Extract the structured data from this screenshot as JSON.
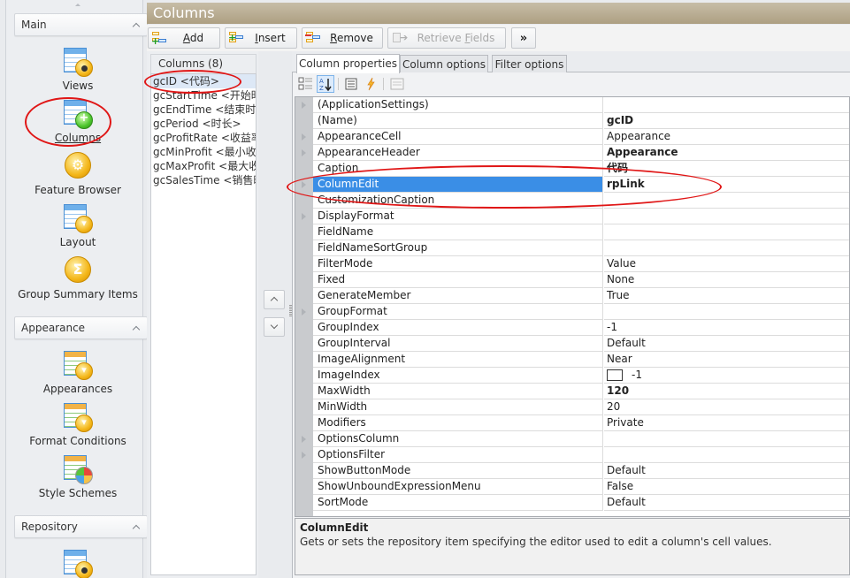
{
  "window": {
    "title": "Columns"
  },
  "nav": {
    "groups": [
      {
        "label": "Main",
        "items": [
          {
            "label": "Views",
            "icon": "views-icon"
          },
          {
            "label": "Columns",
            "icon": "columns-icon",
            "selected": true
          },
          {
            "label": "Feature Browser",
            "icon": "feature-browser-icon"
          },
          {
            "label": "Layout",
            "icon": "layout-icon"
          },
          {
            "label": "Group Summary Items",
            "icon": "group-summary-icon"
          }
        ]
      },
      {
        "label": "Appearance",
        "items": [
          {
            "label": "Appearances",
            "icon": "appearances-icon"
          },
          {
            "label": "Format Conditions",
            "icon": "format-conditions-icon"
          },
          {
            "label": "Style Schemes",
            "icon": "style-schemes-icon"
          }
        ]
      },
      {
        "label": "Repository",
        "items": [
          {
            "label": "",
            "icon": "repository-icon"
          }
        ]
      }
    ]
  },
  "toolbar": {
    "add": {
      "label": "Add",
      "mnemonic": "A",
      "rest": "dd"
    },
    "insert": {
      "label": "Insert",
      "mnemonic": "I",
      "rest": "nsert"
    },
    "remove": {
      "label": "Remove",
      "mnemonic": "R",
      "rest": "emove"
    },
    "retrieve": {
      "label": "Retrieve Fields",
      "pre": "Retrieve ",
      "mnemonic": "F",
      "rest": "ields",
      "disabled": true
    },
    "more": {
      "label": "»"
    }
  },
  "columns_list": {
    "header": "Columns (8)",
    "items": [
      "gcID <代码>",
      "gcStartTime <开始时间>",
      "gcEndTime <结束时间>",
      "gcPeriod <时长>",
      "gcProfitRate <收益率>",
      "gcMinProfit <最小收益>",
      "gcMaxProfit <最大收益>",
      "gcSalesTime <销售时间>"
    ],
    "selected_index": 0
  },
  "tabs": [
    {
      "label": "Column properties",
      "active": true
    },
    {
      "label": "Column options",
      "active": false
    },
    {
      "label": "Filter options",
      "active": false
    }
  ],
  "property_toolbar": {
    "categorized": "categorized-icon",
    "alphabetical": "sort-az-icon",
    "properties": "properties-icon",
    "events": "events-icon",
    "pages": "property-pages-icon"
  },
  "properties": [
    {
      "name": "(ApplicationSettings)",
      "value": "",
      "expandable": true
    },
    {
      "name": "(Name)",
      "value": "gcID",
      "bold": true
    },
    {
      "name": "AppearanceCell",
      "value": "Appearance",
      "expandable": true
    },
    {
      "name": "AppearanceHeader",
      "value": "Appearance",
      "expandable": true,
      "bold": true
    },
    {
      "name": "Caption",
      "value": "代码",
      "bold": true
    },
    {
      "name": "ColumnEdit",
      "value": "rpLink",
      "expandable": true,
      "bold": true,
      "selected": true
    },
    {
      "name": "CustomizationCaption",
      "value": ""
    },
    {
      "name": "DisplayFormat",
      "value": "",
      "expandable": true
    },
    {
      "name": "FieldName",
      "value": ""
    },
    {
      "name": "FieldNameSortGroup",
      "value": ""
    },
    {
      "name": "FilterMode",
      "value": "Value"
    },
    {
      "name": "Fixed",
      "value": "None"
    },
    {
      "name": "GenerateMember",
      "value": "True"
    },
    {
      "name": "GroupFormat",
      "value": "",
      "expandable": true
    },
    {
      "name": "GroupIndex",
      "value": "-1"
    },
    {
      "name": "GroupInterval",
      "value": "Default"
    },
    {
      "name": "ImageAlignment",
      "value": "Near"
    },
    {
      "name": "ImageIndex",
      "value": "-1",
      "swatch": true
    },
    {
      "name": "MaxWidth",
      "value": "120",
      "bold": true
    },
    {
      "name": "MinWidth",
      "value": "20"
    },
    {
      "name": "Modifiers",
      "value": "Private"
    },
    {
      "name": "OptionsColumn",
      "value": "",
      "expandable": true
    },
    {
      "name": "OptionsFilter",
      "value": "",
      "expandable": true
    },
    {
      "name": "ShowButtonMode",
      "value": "Default"
    },
    {
      "name": "ShowUnboundExpressionMenu",
      "value": "False"
    },
    {
      "name": "SortMode",
      "value": "Default"
    }
  ],
  "description": {
    "title": "ColumnEdit",
    "text": "Gets or sets the repository item specifying the editor used to edit a column's cell values."
  },
  "colors": {
    "title_bar": "#b3a68a",
    "selection": "#3a8ee6",
    "annotation": "#e01616"
  }
}
